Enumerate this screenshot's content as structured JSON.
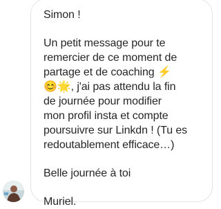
{
  "message": {
    "greeting": "Simon !",
    "line1": "Un petit message pour te\nremercier de ce moment de\npartage et de coaching ",
    "emoji_bolt": "⚡",
    "emoji_smile": "😊",
    "emoji_star": "🌟",
    "line2": ", j'ai pas attendu la fin\nde journée pour modifier\nmon profil insta et compte\npoursuivre sur Linkdn ! (Tu es\nredoutablement efficace…)",
    "closing": "Belle journée à toi",
    "signature": "Muriel."
  },
  "colors": {
    "bubble_border": "#e3e3e3",
    "text": "#262626"
  }
}
